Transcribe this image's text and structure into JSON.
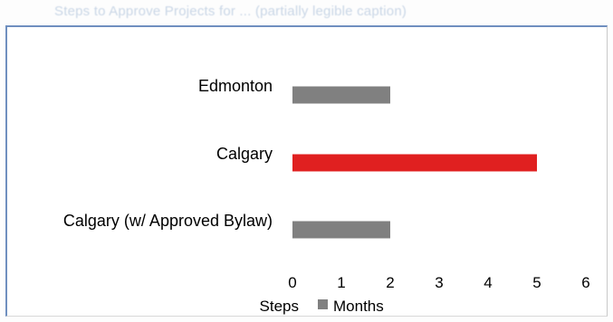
{
  "header": {
    "caption": "Steps to Approve Projects for ... (partially legible caption)"
  },
  "chart_data": {
    "type": "bar",
    "orientation": "horizontal",
    "categories": [
      "Edmonton",
      "Calgary",
      "Calgary (w/ Approved Bylaw)"
    ],
    "series": [
      {
        "name": "Steps",
        "values": [
          0,
          0,
          0
        ],
        "color": "#d9d9d9"
      },
      {
        "name": "Months",
        "values": [
          2,
          5,
          2
        ],
        "colors": [
          "#808080",
          "#e02020",
          "#808080"
        ],
        "color": "#808080"
      }
    ],
    "xlim": [
      0,
      6
    ],
    "xticks": [
      0,
      1,
      2,
      3,
      4,
      5,
      6
    ],
    "legend_position": "bottom",
    "grid": false
  }
}
